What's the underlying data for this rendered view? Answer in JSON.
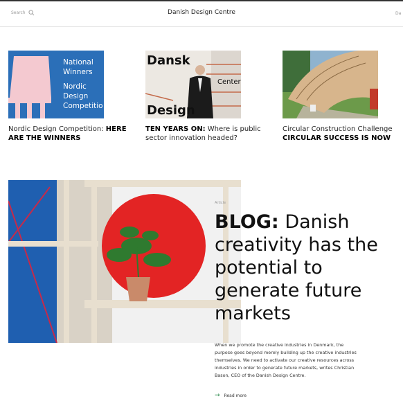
{
  "header": {
    "search_label": "Search",
    "site_title": "Danish Design Centre",
    "right_cut_text": "Da"
  },
  "cards": [
    {
      "image_text": [
        "National",
        "Winners",
        "Nordic",
        "Design",
        "Competitio"
      ],
      "caption_lead": "Nordic Design Competition: ",
      "caption_bold": "HERE ARE THE WINNERS"
    },
    {
      "image_text": [
        "Dansk",
        "Center",
        "Design"
      ],
      "caption_bold": "TEN YEARS ON:",
      "caption_rest": " Where is public sector innovation headed?"
    },
    {
      "caption_lead": "Circular Construction Challenge",
      "caption_bold": "CIRCULAR SUCCESS IS NOW"
    }
  ],
  "article": {
    "label": "Article",
    "title_bold": "BLOG:",
    "title_rest": " Danish creativity has the potential to generate future markets",
    "body": "When we promote the creative industries in Denmark, the purpose goes beyond merely building up the creative industries themselves. We need to activate our creative resources across industries in order to generate future markets, writes Christian Bason, CEO of the Danish Design Centre.",
    "read_more": "Read more"
  },
  "colors": {
    "accent_blue": "#2b6fb8",
    "hero_red": "#e32424",
    "read_more_arrow": "#2a8a4a"
  },
  "icons": [
    "search-icon",
    "arrow-right-icon"
  ]
}
